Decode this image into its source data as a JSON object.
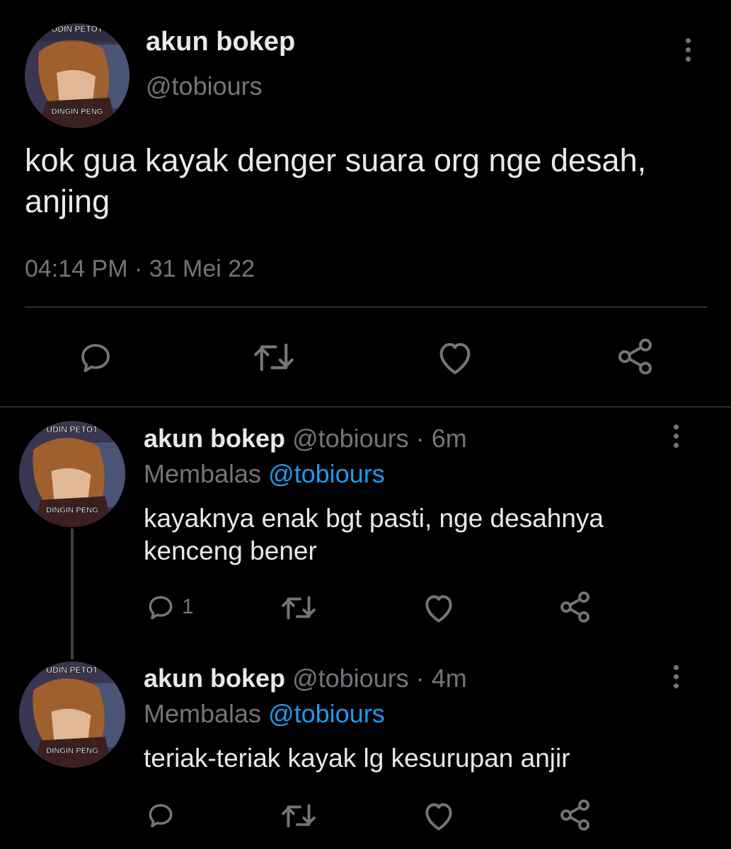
{
  "main_tweet": {
    "display_name": "akun bokep",
    "handle": "@tobiours",
    "avatar_caption_top": "UDIN PETOT",
    "avatar_caption_bottom": "DINGIN PENG",
    "text": "kok gua kayak denger suara org nge desah, anjing",
    "timestamp": "04:14 PM · 31 Mei 22"
  },
  "replies": [
    {
      "display_name": "akun bokep",
      "handle": "@tobiours",
      "time": "· 6m",
      "replying_label": "Membalas",
      "replying_to": "@tobiours",
      "text": "kayaknya enak bgt pasti, nge desahnya kenceng bener",
      "reply_count": "1",
      "avatar_caption_top": "UDIN PETOT",
      "avatar_caption_bottom": "DINGIN PENG"
    },
    {
      "display_name": "akun bokep",
      "handle": "@tobiours",
      "time": "· 4m",
      "replying_label": "Membalas",
      "replying_to": "@tobiours",
      "text": "teriak-teriak kayak lg kesurupan anjir",
      "reply_count": "",
      "avatar_caption_top": "UDIN PETOT",
      "avatar_caption_bottom": "DINGIN PENG"
    }
  ],
  "icons": [
    "reply-icon",
    "retweet-icon",
    "like-icon",
    "share-icon",
    "more-icon"
  ],
  "colors": {
    "background": "#000000",
    "text": "#e7e9ea",
    "muted": "#71767b",
    "link": "#1d9bf0",
    "divider": "#2f3336"
  }
}
